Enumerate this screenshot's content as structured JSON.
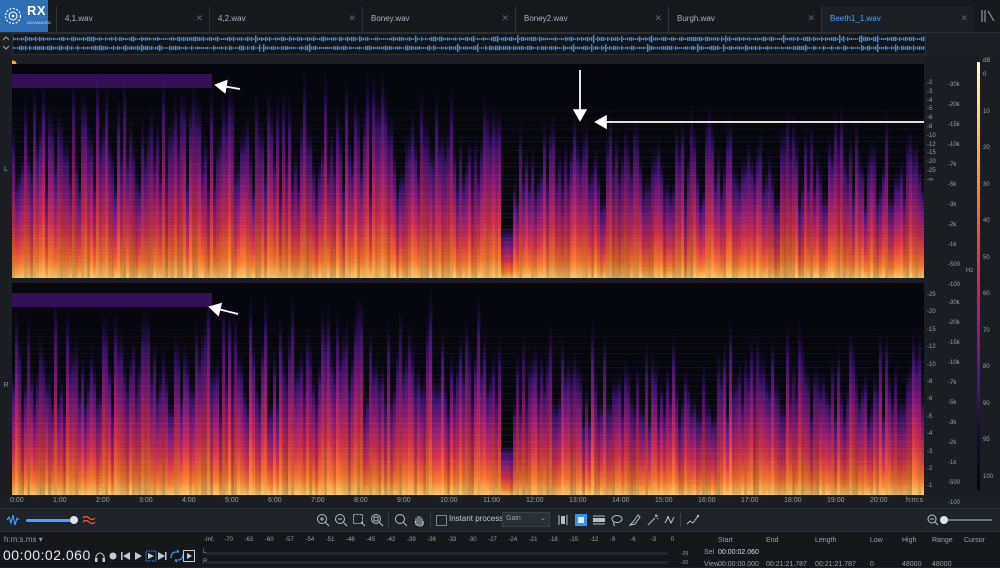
{
  "app": {
    "logo_text": "RX",
    "logo_subtext": "ADVANCED"
  },
  "tabs": [
    {
      "label": "4,1.wav",
      "active": false
    },
    {
      "label": "4,2.wav",
      "active": false
    },
    {
      "label": "Boney.wav",
      "active": false
    },
    {
      "label": "Boney2.wav",
      "active": false
    },
    {
      "label": "Burgh.wav",
      "active": false
    },
    {
      "label": "Beeth1_1.wav",
      "active": true
    }
  ],
  "channels": {
    "left_label": "L",
    "right_label": "R"
  },
  "db_ruler_ticks": [
    "-2",
    "-3",
    "-4",
    "-5",
    "-6",
    "-8",
    "-10",
    "-12",
    "-15",
    "-20",
    "-25",
    "-∞",
    "-25",
    "-20",
    "-15",
    "-12",
    "-10",
    "-8",
    "-6",
    "-5",
    "-4",
    "-3",
    "-2",
    "-1"
  ],
  "hz_ruler_ticks": [
    "-30k",
    "-20k",
    "-15k",
    "-10k",
    "-7k",
    "-5k",
    "-3k",
    "-2k",
    "-1k",
    "-500",
    "-100"
  ],
  "hz_units": "Hz",
  "colorbar": {
    "unit": "dB",
    "ticks": [
      "0",
      "10",
      "20",
      "30",
      "40",
      "50",
      "60",
      "70",
      "80",
      "90",
      "95",
      "100"
    ]
  },
  "time_ruler": {
    "ticks": [
      "0:00",
      "1:00",
      "2:00",
      "3:00",
      "4:00",
      "5:00",
      "6:00",
      "7:00",
      "8:00",
      "9:00",
      "10:00",
      "11:00",
      "12:00",
      "13:00",
      "14:00",
      "15:00",
      "16:00",
      "17:00",
      "18:00",
      "19:00",
      "20:00"
    ],
    "units": "h:m:s"
  },
  "toolbar": {
    "instant_process_label": "Instant process",
    "gain_select": "Gain"
  },
  "transport": {
    "time_format": "h:m:s.ms",
    "timecode": "00:00:02.060"
  },
  "meter": {
    "scale": [
      "-Inf.",
      "-70",
      "-63",
      "-60",
      "-57",
      "-54",
      "-51",
      "-48",
      "-45",
      "-42",
      "-39",
      "-36",
      "-33",
      "-30",
      "-27",
      "-24",
      "-21",
      "-18",
      "-15",
      "-12",
      "-9",
      "-6",
      "-3",
      "0"
    ],
    "left_label": "L",
    "right_label": "R",
    "right_ticks": [
      "-25",
      "-20"
    ]
  },
  "selection_info": {
    "headers": [
      "Start",
      "End",
      "Length",
      "Low",
      "High",
      "Range",
      "Cursor"
    ],
    "sel_label": "Sel",
    "sel_start": "00:00:02.060",
    "view_label": "View",
    "view_start": "00:00:00.000",
    "view_end": "00:21:21.787",
    "view_length": "00:21:21.787",
    "view_low": "0",
    "view_high": "48000",
    "view_range": "48000"
  },
  "colors": {
    "accent": "#4aa3ff",
    "logo_bg": "#2f6fb4",
    "background": "#1c1f24"
  }
}
